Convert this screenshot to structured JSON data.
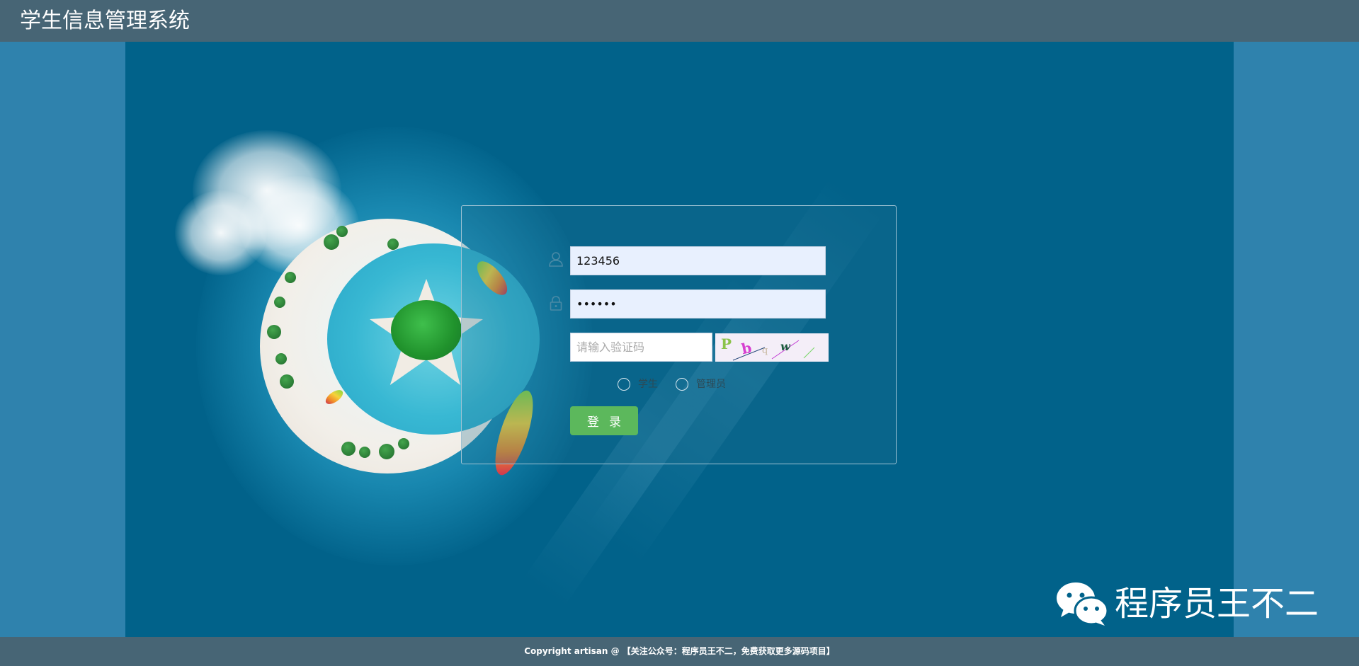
{
  "header": {
    "title": "学生信息管理系统"
  },
  "login": {
    "username_value": "123456",
    "password_value": "123456",
    "captcha_placeholder": "请输入验证码",
    "captcha_text": "Pbqw",
    "role_options": [
      {
        "label": "学生",
        "selected": false
      },
      {
        "label": "管理员",
        "selected": false
      }
    ],
    "submit_label": "登录"
  },
  "watermark": {
    "text": "程序员王不二",
    "icon": "wechat-icon"
  },
  "footer": {
    "text": "Copyright   artisan @ 【关注公众号：程序员王不二，免费获取更多源码项目】"
  },
  "colors": {
    "topbar": "#476575",
    "stage": "#01628a",
    "side_panels": "#2f82ad",
    "input_bg": "#e8f0fe",
    "button": "#5cb85c"
  }
}
